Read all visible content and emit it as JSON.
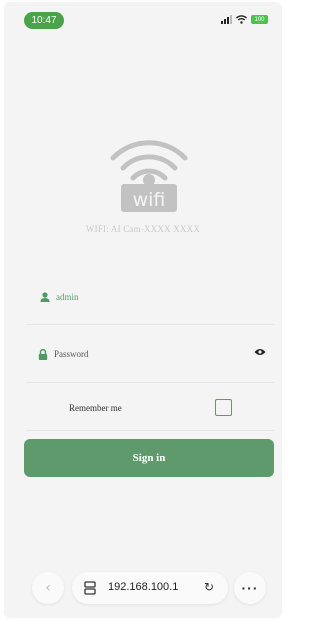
{
  "status_bar": {
    "time": "10:47",
    "battery": "100",
    "icons": [
      "cellular-signal-icon",
      "wifi-icon",
      "battery-icon"
    ]
  },
  "logo": {
    "icon": "wifi-logo-icon",
    "text": "wifi"
  },
  "wifi_name": "WIFI: AI Cam-XXXX XXXX",
  "form": {
    "username_value": "admin",
    "password_placeholder": "Password",
    "remember_label": "Remember me",
    "remember_checked": false,
    "sign_in_label": "Sign in"
  },
  "browser": {
    "url": "192.168.100.1",
    "more_label": "···"
  },
  "colors": {
    "accent": "#5f9a6d",
    "time_pill": "#4aa24a",
    "battery": "#4cc44c"
  }
}
